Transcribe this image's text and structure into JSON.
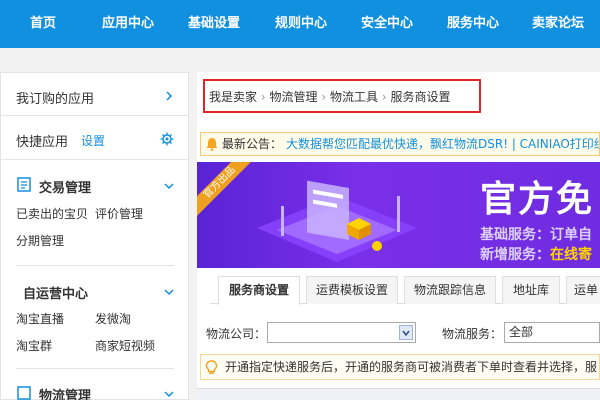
{
  "topnav": {
    "items": [
      "首页",
      "应用中心",
      "基础设置",
      "规则中心",
      "安全中心",
      "服务中心",
      "卖家论坛"
    ]
  },
  "sidebar": {
    "subscribed": "我订购的应用",
    "quick": {
      "label": "快捷应用",
      "settings": "设置"
    },
    "trade": {
      "title": "交易管理",
      "links": [
        "已卖出的宝贝",
        "评价管理",
        "分期管理"
      ]
    },
    "selfop": {
      "title": "自运营中心",
      "links": [
        "淘宝直播",
        "发微淘",
        "淘宝群",
        "商家短视频"
      ]
    },
    "logistics": {
      "title": "物流管理"
    }
  },
  "breadcrumb": [
    "我是卖家",
    "物流管理",
    "物流工具",
    "服务商设置"
  ],
  "notice": {
    "label": "最新公告：",
    "text": "大数据帮您匹配最优快递，飘红物流DSR! | CAINIAO打印组"
  },
  "banner": {
    "ribbon": "官方出品",
    "headline": "官方免",
    "line1": "基础服务：订单自",
    "line2_prefix": "新增服务：",
    "line2_highlight": "在线寄"
  },
  "tabs": [
    "服务商设置",
    "运费模板设置",
    "物流跟踪信息",
    "地址库",
    "运单"
  ],
  "form": {
    "company_label": "物流公司：",
    "company_value": "",
    "service_label": "物流服务：",
    "service_value": "全部"
  },
  "tip": "开通指定快递服务后，开通的服务商可被消费者下单时查看并选择，服",
  "colors": {
    "brand": "#1190e0",
    "highlight_box": "#e0262a",
    "banner": "#6f2ce0"
  }
}
